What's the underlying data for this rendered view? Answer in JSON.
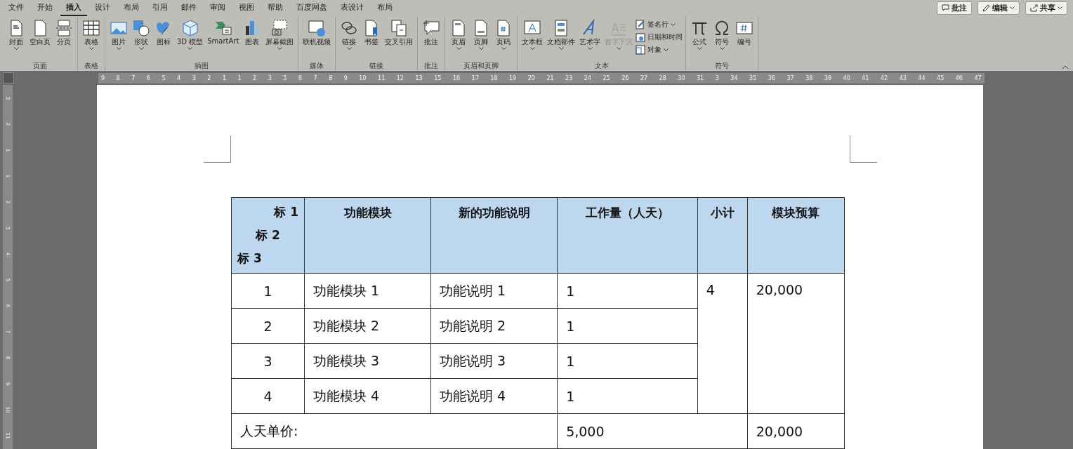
{
  "menu_tabs": [
    {
      "label": "文件",
      "selected": false
    },
    {
      "label": "开始",
      "selected": false
    },
    {
      "label": "插入",
      "selected": true
    },
    {
      "label": "设计",
      "selected": false
    },
    {
      "label": "布局",
      "selected": false
    },
    {
      "label": "引用",
      "selected": false
    },
    {
      "label": "邮件",
      "selected": false
    },
    {
      "label": "审阅",
      "selected": false
    },
    {
      "label": "视图",
      "selected": false
    },
    {
      "label": "帮助",
      "selected": false
    },
    {
      "label": "百度网盘",
      "selected": false
    },
    {
      "label": "表设计",
      "selected": false
    },
    {
      "label": "布局",
      "selected": false
    }
  ],
  "top_buttons": [
    {
      "label": "批注",
      "dropdown": false
    },
    {
      "label": "编辑",
      "dropdown": true
    },
    {
      "label": "共享",
      "dropdown": true
    }
  ],
  "ribbon_groups": [
    {
      "label": "页面",
      "items": [
        {
          "kind": "large",
          "label": "封面",
          "dropdown": true,
          "disabled": false
        },
        {
          "kind": "large",
          "label": "空白页",
          "dropdown": false,
          "disabled": false
        },
        {
          "kind": "large",
          "label": "分页",
          "dropdown": false,
          "disabled": false
        }
      ]
    },
    {
      "label": "表格",
      "items": [
        {
          "kind": "large",
          "label": "表格",
          "dropdown": true,
          "disabled": false
        }
      ]
    },
    {
      "label": "插图",
      "items": [
        {
          "kind": "large",
          "label": "图片",
          "dropdown": true,
          "disabled": false
        },
        {
          "kind": "large",
          "label": "形状",
          "dropdown": true,
          "disabled": false
        },
        {
          "kind": "large",
          "label": "图标",
          "dropdown": false,
          "disabled": false
        },
        {
          "kind": "large",
          "label": "3D 模型",
          "dropdown": true,
          "disabled": false
        },
        {
          "kind": "large",
          "label": "SmartArt",
          "dropdown": false,
          "disabled": false
        },
        {
          "kind": "large",
          "label": "图表",
          "dropdown": false,
          "disabled": false
        },
        {
          "kind": "large",
          "label": "屏幕截图",
          "dropdown": true,
          "disabled": false
        }
      ]
    },
    {
      "label": "媒体",
      "items": [
        {
          "kind": "large",
          "label": "联机视频",
          "dropdown": false,
          "disabled": false
        }
      ]
    },
    {
      "label": "链接",
      "items": [
        {
          "kind": "large",
          "label": "链接",
          "dropdown": true,
          "disabled": false
        },
        {
          "kind": "large",
          "label": "书签",
          "dropdown": false,
          "disabled": false
        },
        {
          "kind": "large",
          "label": "交叉引用",
          "dropdown": false,
          "disabled": false
        }
      ]
    },
    {
      "label": "批注",
      "items": [
        {
          "kind": "large",
          "label": "批注",
          "dropdown": false,
          "disabled": false
        }
      ]
    },
    {
      "label": "页眉和页脚",
      "items": [
        {
          "kind": "large",
          "label": "页眉",
          "dropdown": true,
          "disabled": false
        },
        {
          "kind": "large",
          "label": "页脚",
          "dropdown": true,
          "disabled": false
        },
        {
          "kind": "large",
          "label": "页码",
          "dropdown": true,
          "disabled": false
        }
      ]
    },
    {
      "label": "文本",
      "items": [
        {
          "kind": "large",
          "label": "文本框",
          "dropdown": true,
          "disabled": false
        },
        {
          "kind": "large",
          "label": "文档部件",
          "dropdown": true,
          "disabled": false
        },
        {
          "kind": "large",
          "label": "艺术字",
          "dropdown": true,
          "disabled": false
        },
        {
          "kind": "large",
          "label": "首字下沉",
          "dropdown": true,
          "disabled": true
        },
        {
          "kind": "small",
          "label": "签名行",
          "dropdown": true,
          "disabled": false
        },
        {
          "kind": "small",
          "label": "日期和时间",
          "dropdown": false,
          "disabled": false
        },
        {
          "kind": "small",
          "label": "对象",
          "dropdown": true,
          "disabled": false
        }
      ]
    },
    {
      "label": "符号",
      "items": [
        {
          "kind": "large",
          "label": "公式",
          "dropdown": true,
          "disabled": false
        },
        {
          "kind": "large",
          "label": "符号",
          "dropdown": true,
          "disabled": false
        },
        {
          "kind": "large",
          "label": "编号",
          "dropdown": false,
          "disabled": false
        }
      ]
    }
  ],
  "horizontal_ruler": [
    "9",
    "8",
    "7",
    "6",
    "5",
    "4",
    "3",
    "2",
    "1",
    "1",
    "2",
    "3",
    "5",
    "6",
    "7",
    "8",
    "9",
    "10",
    "11",
    "12",
    "13",
    "15",
    "16",
    "17",
    "18",
    "19",
    "20",
    "21",
    "23",
    "24",
    "25",
    "26",
    "27",
    "28",
    "30",
    "31",
    "3",
    "34",
    "35",
    "36",
    "37",
    "38",
    "39",
    "40",
    "41",
    "42",
    "43",
    "44",
    "45",
    "46",
    "47"
  ],
  "vertical_ruler": [
    "3",
    "2",
    "1",
    "1",
    "2",
    "3",
    "4",
    "5",
    "6",
    "7",
    "8",
    "9",
    "10",
    "11"
  ],
  "table": {
    "columns": [
      "标 1\n标 2\n标 3",
      "功能模块",
      "新的功能说明",
      "工作量（人天）",
      "小计",
      "模块预算"
    ],
    "rows": [
      [
        "1",
        "功能模块 1",
        "功能说明 1",
        "1",
        {
          "text": "4",
          "rowspan": 4
        },
        {
          "text": "20,000",
          "rowspan": 4
        }
      ],
      [
        "2",
        "功能模块 2",
        "功能说明 2",
        "1"
      ],
      [
        "3",
        "功能模块 3",
        "功能说明 3",
        "1"
      ],
      [
        "4",
        "功能模块 4",
        "功能说明 4",
        "1"
      ],
      [
        {
          "text": "人天单价:",
          "colspan": 3
        },
        {
          "text": "5,000",
          "colspan": 2
        },
        "20,000"
      ]
    ]
  }
}
